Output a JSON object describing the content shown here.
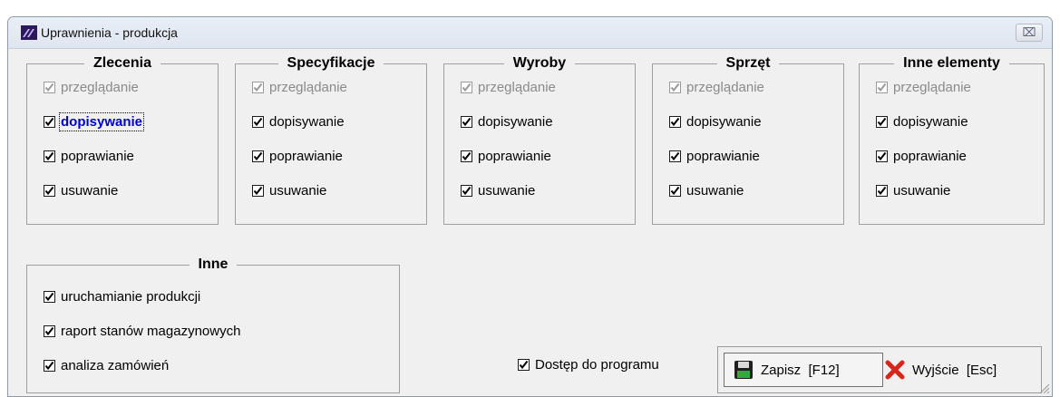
{
  "window": {
    "title": "Uprawnienia - produkcja",
    "close_symbol": "⌧"
  },
  "groups": [
    {
      "title": "Zlecenia",
      "items": [
        {
          "label": "przeglądanie",
          "checked": true,
          "enabled": false
        },
        {
          "label": "dopisywanie",
          "checked": true,
          "enabled": true,
          "focused": true
        },
        {
          "label": "poprawianie",
          "checked": true,
          "enabled": true
        },
        {
          "label": "usuwanie",
          "checked": true,
          "enabled": true
        }
      ]
    },
    {
      "title": "Specyfikacje",
      "items": [
        {
          "label": "przeglądanie",
          "checked": true,
          "enabled": false
        },
        {
          "label": "dopisywanie",
          "checked": true,
          "enabled": true
        },
        {
          "label": "poprawianie",
          "checked": true,
          "enabled": true
        },
        {
          "label": "usuwanie",
          "checked": true,
          "enabled": true
        }
      ]
    },
    {
      "title": "Wyroby",
      "items": [
        {
          "label": "przeglądanie",
          "checked": true,
          "enabled": false
        },
        {
          "label": "dopisywanie",
          "checked": true,
          "enabled": true
        },
        {
          "label": "poprawianie",
          "checked": true,
          "enabled": true
        },
        {
          "label": "usuwanie",
          "checked": true,
          "enabled": true
        }
      ]
    },
    {
      "title": "Sprzęt",
      "items": [
        {
          "label": "przeglądanie",
          "checked": true,
          "enabled": false
        },
        {
          "label": "dopisywanie",
          "checked": true,
          "enabled": true
        },
        {
          "label": "poprawianie",
          "checked": true,
          "enabled": true
        },
        {
          "label": "usuwanie",
          "checked": true,
          "enabled": true
        }
      ]
    },
    {
      "title": "Inne elementy",
      "items": [
        {
          "label": "przeglądanie",
          "checked": true,
          "enabled": false
        },
        {
          "label": "dopisywanie",
          "checked": true,
          "enabled": true
        },
        {
          "label": "poprawianie",
          "checked": true,
          "enabled": true
        },
        {
          "label": "usuwanie",
          "checked": true,
          "enabled": true
        }
      ]
    }
  ],
  "other": {
    "title": "Inne",
    "items": [
      {
        "label": "uruchamianie produkcji",
        "checked": true,
        "enabled": true
      },
      {
        "label": "raport stanów magazynowych",
        "checked": true,
        "enabled": true
      },
      {
        "label": "analiza zamówień",
        "checked": true,
        "enabled": true
      }
    ]
  },
  "access": {
    "label": "Dostęp do programu",
    "checked": true
  },
  "buttons": {
    "save_label": "Zapisz  [F12]",
    "save_icon": "floppy-disk-icon",
    "exit_label": "Wyjście  [Esc]",
    "exit_icon": "red-x-icon"
  },
  "colors": {
    "focused_text": "#0000cc",
    "disabled_text": "#8a8a8a",
    "exit_icon": "#d9261c",
    "save_icon": "#1e7a2e"
  }
}
